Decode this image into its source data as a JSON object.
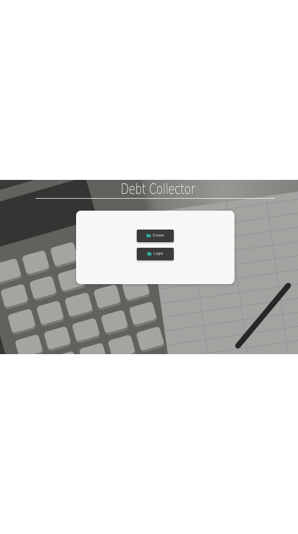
{
  "header": {
    "title": "Debt Collector"
  },
  "actions": {
    "create_label": "Create",
    "login_label": "Login"
  },
  "icons": {
    "create_icon": "folder-icon",
    "login_icon": "folder-icon"
  },
  "colors": {
    "button_bg": "#3a3a3a",
    "icon_accent": "#2bb3a3",
    "card_bg": "#f7f7f7"
  }
}
